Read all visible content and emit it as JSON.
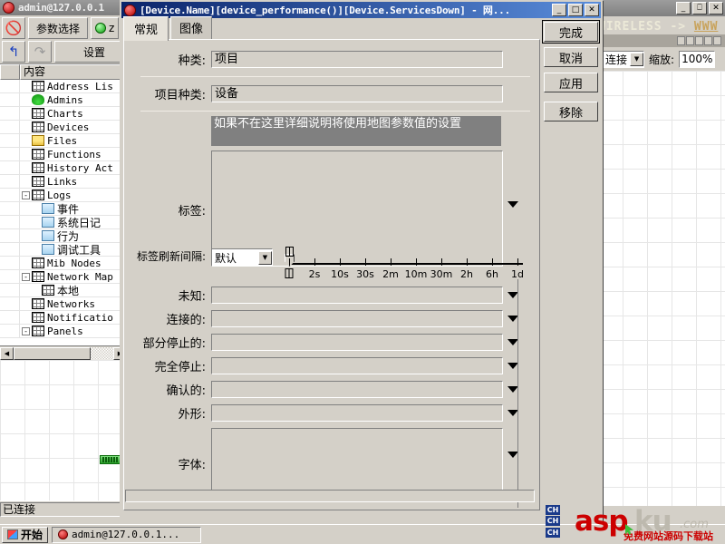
{
  "background_window": {
    "title": "admin@127.0.0.1",
    "title_icon": "red-ball-icon",
    "toolbar": {
      "deny_icon": "deny-icon",
      "params_button": "参数选择",
      "status_ball_icon": "green-ball-icon",
      "status_text": "z",
      "undo_icon": "undo-icon",
      "redo_icon": "redo-icon",
      "settings_button": "设置"
    },
    "tree": {
      "column_header": "内容",
      "items": [
        {
          "label": "Address Lis",
          "icon": "table-icon",
          "indent": 1,
          "expander": ""
        },
        {
          "label": "Admins",
          "icon": "admin-icon",
          "indent": 1,
          "expander": ""
        },
        {
          "label": "Charts",
          "icon": "table-icon",
          "indent": 1,
          "expander": ""
        },
        {
          "label": "Devices",
          "icon": "table-icon",
          "indent": 1,
          "expander": ""
        },
        {
          "label": "Files",
          "icon": "folder-icon",
          "indent": 1,
          "expander": ""
        },
        {
          "label": "Functions",
          "icon": "table-icon",
          "indent": 1,
          "expander": ""
        },
        {
          "label": "History Act",
          "icon": "table-icon",
          "indent": 1,
          "expander": ""
        },
        {
          "label": "Links",
          "icon": "table-icon",
          "indent": 1,
          "expander": ""
        },
        {
          "label": "Logs",
          "icon": "table-icon",
          "indent": 1,
          "expander": "-"
        },
        {
          "label": "事件",
          "icon": "log-icon",
          "indent": 2,
          "expander": ""
        },
        {
          "label": "系统日记",
          "icon": "log-icon",
          "indent": 2,
          "expander": ""
        },
        {
          "label": "行为",
          "icon": "log-icon",
          "indent": 2,
          "expander": ""
        },
        {
          "label": "调试工具",
          "icon": "log-icon",
          "indent": 2,
          "expander": ""
        },
        {
          "label": "Mib Nodes",
          "icon": "table-icon",
          "indent": 1,
          "expander": ""
        },
        {
          "label": "Network Map",
          "icon": "table-icon",
          "indent": 1,
          "expander": "-"
        },
        {
          "label": "本地",
          "icon": "table-icon",
          "indent": 2,
          "expander": ""
        },
        {
          "label": "Networks",
          "icon": "table-icon",
          "indent": 1,
          "expander": ""
        },
        {
          "label": "Notificatio",
          "icon": "table-icon",
          "indent": 1,
          "expander": ""
        },
        {
          "label": "Panels",
          "icon": "table-icon",
          "indent": 1,
          "expander": "-"
        }
      ]
    },
    "status_bar": {
      "text": "已连接"
    }
  },
  "right_window": {
    "caption_prefix": "WIRELESS -> ",
    "caption_link": "WWW",
    "connect_select": "连接",
    "zoom_label": "缩放:",
    "zoom_value": "100%"
  },
  "dialog": {
    "title": "[Device.Name][device_performance()][Device.ServicesDown] - 网...",
    "title_icon": "red-ball-icon",
    "window_buttons": {
      "minimize": "_",
      "maximize": "□",
      "close": "✕"
    },
    "tabs": [
      {
        "label": "常规",
        "active": true
      },
      {
        "label": "图像",
        "active": false
      }
    ],
    "fields": [
      {
        "label": "种类:",
        "value": "项目"
      },
      {
        "label": "项目种类:",
        "value": "设备"
      }
    ],
    "hint_banner": "如果不在这里详细说明将使用地图参数值的设置",
    "label_field": {
      "label": "标签:",
      "value": ""
    },
    "refresh_interval": {
      "label": "标签刷新间隔:",
      "select_value": "默认",
      "slider_ticks": [
        "",
        "2s",
        "10s",
        "30s",
        "2m",
        "10m",
        "30m",
        "2h",
        "6h",
        "1d"
      ]
    },
    "state_fields": [
      {
        "label": "未知:",
        "value": ""
      },
      {
        "label": "连接的:",
        "value": ""
      },
      {
        "label": "部分停止的:",
        "value": ""
      },
      {
        "label": "完全停止:",
        "value": ""
      },
      {
        "label": "确认的:",
        "value": ""
      },
      {
        "label": "外形:",
        "value": ""
      }
    ],
    "font_field": {
      "label": "字体:",
      "value": ""
    },
    "buttons": [
      {
        "label": "完成",
        "default": true
      },
      {
        "label": "取消",
        "default": false
      },
      {
        "label": "应用",
        "default": false
      },
      {
        "label": "移除",
        "default": false
      }
    ]
  },
  "taskbar": {
    "start_label": "开始",
    "start_icon": "windows-flag-icon",
    "tasks": [
      {
        "label": "admin@127.0.0.1...",
        "icon": "red-ball-icon"
      }
    ]
  },
  "watermark": {
    "badge1": "CH",
    "badge2": "CH",
    "badge3": "CH",
    "brand_red": "asp",
    "brand_grey": "ku",
    "domain": ".com",
    "tagline": "免费网站源码下载站"
  },
  "colors": {
    "title_active": "#0a246a",
    "title_inactive": "#808080",
    "face": "#d4d0c8",
    "accent_red": "#cc0000"
  }
}
